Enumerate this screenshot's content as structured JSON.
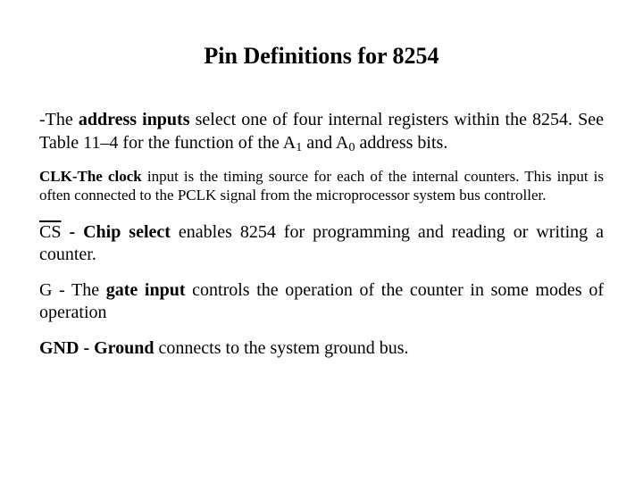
{
  "title": "Pin Definitions for 8254",
  "para1": {
    "lead": "-The ",
    "bold1": "address inputs",
    "mid1": " select one of four internal registers within the 8254. See Table 11–4 for the function of the A",
    "sub1": "1",
    "mid2": " and A",
    "sub2": "0",
    "tail": " address bits."
  },
  "para2": {
    "bold1": "CLK-The clock",
    "rest": " input is the timing source for each of the internal counters. This input is often connected to the PCLK signal from the microprocessor system bus controller."
  },
  "para3": {
    "cs": "CS",
    "bold1": " - Chip select",
    "rest": " enables 8254 for programming and reading or writing a counter."
  },
  "para4": {
    "lead": "G - The ",
    "bold1": "gate input",
    "rest": " controls the operation of the counter in some modes of operation"
  },
  "para5": {
    "bold1": "GND - Ground",
    "rest": " connects to the system ground bus."
  }
}
